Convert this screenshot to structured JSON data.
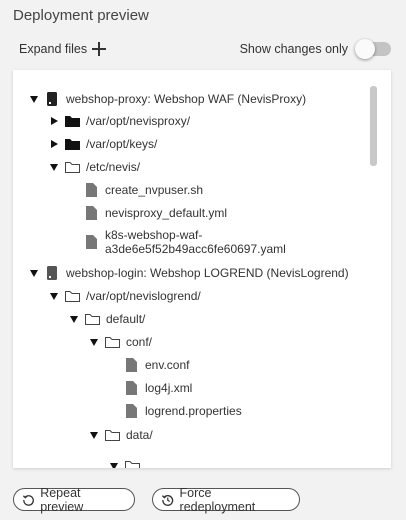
{
  "header": {
    "title": "Deployment preview"
  },
  "toolbar": {
    "expand_label": "Expand files",
    "show_changes_label": "Show changes only",
    "show_changes_on": false
  },
  "tree": {
    "n0": "webshop-proxy: Webshop WAF (NevisProxy)",
    "n1": "/var/opt/nevisproxy/",
    "n2": "/var/opt/keys/",
    "n3": "/etc/nevis/",
    "n4": "create_nvpuser.sh",
    "n5": "nevisproxy_default.yml",
    "n6": "k8s-webshop-waf-a3de6e5f52b49acc6fe60697.yaml",
    "n7": "webshop-login: Webshop LOGREND (NevisLogrend)",
    "n8": "/var/opt/nevislogrend/",
    "n9": "default/",
    "n10": "conf/",
    "n11": "env.conf",
    "n12": "log4j.xml",
    "n13": "logrend.properties",
    "n14": "data/"
  },
  "actions": {
    "repeat_label": "Repeat preview",
    "force_label": "Force redeployment"
  }
}
